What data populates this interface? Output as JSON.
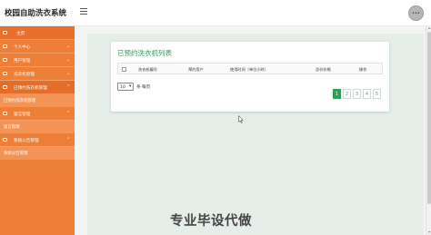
{
  "header": {
    "title": "校园自助洗衣系统",
    "avatar_text": "•••"
  },
  "sidebar": {
    "items": [
      {
        "label": "主页",
        "type": "home"
      },
      {
        "label": "个人中心",
        "type": "group"
      },
      {
        "label": "用户管理",
        "type": "group"
      },
      {
        "label": "洗衣机管理",
        "type": "group"
      },
      {
        "label": "已预约洗衣机管理",
        "type": "group-open"
      },
      {
        "label": "已预约洗衣机管理",
        "type": "sub"
      },
      {
        "label": "留言管理",
        "type": "group"
      },
      {
        "label": "留言管理",
        "type": "sub"
      },
      {
        "label": "系统公告管理",
        "type": "group"
      },
      {
        "label": "系统公告管理",
        "type": "sub"
      }
    ]
  },
  "main": {
    "card_title": "已预约洗衣机列表",
    "columns": [
      "洗衣机编号",
      "预约用户",
      "使用时间（单位小时）",
      "总价价格",
      "操作"
    ],
    "page_size": "10",
    "page_size_suffix": "条 每页",
    "pages": [
      "1",
      "2",
      "3",
      "4",
      "5"
    ],
    "current_page": "1"
  },
  "watermark": "专业毕设代做",
  "colors": {
    "sidebar": "#ee7f37",
    "accent_green": "#2e9d58",
    "content_bg": "#e6eee9"
  }
}
